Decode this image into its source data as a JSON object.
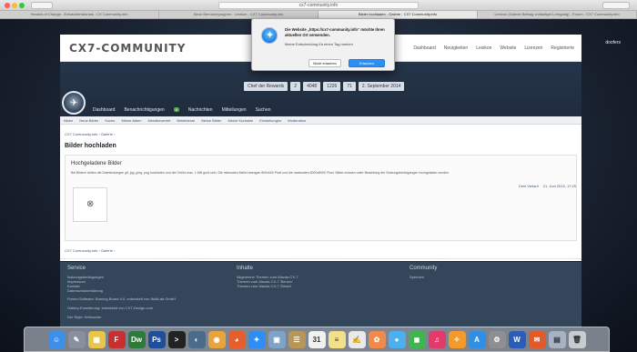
{
  "browser": {
    "url": "cx7-community.info",
    "tabs": [
      "Heralds of Change - Entwicklertutorials - CX Community.info",
      "Neue Benutzergruppen - Lexikon - CX7 Community.info",
      "Bilder hochladen - Galerie - CX7 Community.info",
      "Lexicon (Galerie Beitrag vorläufiger Lehrgang) - Forum - CX7 Community.info"
    ]
  },
  "site": {
    "logo": "CX7-COMMUNITY",
    "logo_sub": "",
    "top_nav": [
      "Dashboard",
      "Neuigkeiten",
      "Lexikon",
      "Website",
      "Lizenzen",
      "Registrierte"
    ],
    "stats": [
      "Chef der Rewards",
      "2",
      "4048",
      "1226",
      "71",
      "2. September 2014"
    ],
    "subnav": [
      "Dashboard",
      "Benachrichtigungen",
      "Nachrichten",
      "Mitteilungen",
      "Suchen"
    ],
    "subnav_badge": "9",
    "crumbs_bar": [
      "Alben",
      "Neue Bilder",
      "Suche",
      "Meine Alben",
      "Meistbewertet",
      "Beliebteste",
      "Meine Bilder",
      "Meine Kontakte",
      "Einstellungen",
      "Moderation"
    ],
    "side_tag": "doofers"
  },
  "content": {
    "crumb": "CX7 Community.info › Galerie ›",
    "page_title": "Bilder hochladen",
    "box_title": "Hochgeladene Bilder",
    "box_text": "Bei Bildern dürfen die Dateiendungen gif, jpg, jpeg, png hochladen und die Größe max. 1 MB groß sein. Die minimalen Maße betragen 800x600 Pixel und die maximalen 8000x8000 Pixel. Bilder müssen unter Beachtung der Nutzungsbedingungen hochgeladen werden.",
    "crumb2": "CX7 Community.info › Galerie ›",
    "tools": [
      "Dein Verlauf",
      "21. Juni 2015, 17:25"
    ]
  },
  "footer": {
    "col1_title": "Service",
    "col1_items": [
      "Nutzungsbedingungen",
      "Impressum",
      "Kontakt",
      "Datenschutzerklärung"
    ],
    "col2_title": "Inhalte",
    "col2_items": [
      "Allgemeine Themen zum Mazda CX-7",
      "Themen zum Mazda CX-7 'Benzin'",
      "Themen zum Mazda CX-7 'Diesel'"
    ],
    "col3_title": "Community",
    "col3_items": [
      "Spenden"
    ],
    "line1": "Forum-Software: Burning Board 4.0, entwickelt von WoltLab GmbH",
    "line2": "Gallery-Erweiterung: entwickelt von CX7-Design.com",
    "line3": "Der Style: Hörbacher"
  },
  "dialog": {
    "text": "Die Website „https://cx7-community.info“ möchte Ihren aktuellen Ort verwenden.",
    "checkbox": "Meine Entscheidung für einen Tag merken",
    "deny": "Nicht erlauben",
    "allow": "Erlauben"
  },
  "dock": {
    "icons": [
      {
        "name": "finder-icon",
        "color": "#3d8fe8",
        "glyph": "☺"
      },
      {
        "name": "launchpad-icon",
        "color": "#8a8fa0",
        "glyph": "✎"
      },
      {
        "name": "notes-icon",
        "color": "#e8c64a",
        "glyph": "▦"
      },
      {
        "name": "filezilla-icon",
        "color": "#c8302f",
        "glyph": "F"
      },
      {
        "name": "dreamweaver-icon",
        "color": "#2d7a3a",
        "glyph": "Dw"
      },
      {
        "name": "photoshop-icon",
        "color": "#1f4f9a",
        "glyph": "Ps"
      },
      {
        "name": "terminal-icon",
        "color": "#222222",
        "glyph": ">"
      },
      {
        "name": "bridge-icon",
        "color": "#4a6b8a",
        "glyph": "◐"
      },
      {
        "name": "chrome-icon",
        "color": "#e8a33a",
        "glyph": "◉"
      },
      {
        "name": "firefox-icon",
        "color": "#e85d2a",
        "glyph": "◕"
      },
      {
        "name": "safari-icon",
        "color": "#2d8ff5",
        "glyph": "✦"
      },
      {
        "name": "preview-icon",
        "color": "#7fa2c8",
        "glyph": "▣"
      },
      {
        "name": "contacts-icon",
        "color": "#b8965a",
        "glyph": "☰"
      },
      {
        "name": "calendar-icon",
        "color": "#f1f1f1",
        "glyph": "31"
      },
      {
        "name": "notes2-icon",
        "color": "#f3e08a",
        "glyph": "≡"
      },
      {
        "name": "textedit-icon",
        "color": "#e9e9e9",
        "glyph": "✍"
      },
      {
        "name": "photos-icon",
        "color": "#f08a4b",
        "glyph": "✿"
      },
      {
        "name": "messages-icon",
        "color": "#4bb0f0",
        "glyph": "●"
      },
      {
        "name": "facetime-icon",
        "color": "#3fb54d",
        "glyph": "◼"
      },
      {
        "name": "itunes-icon",
        "color": "#e23a6b",
        "glyph": "♫"
      },
      {
        "name": "ibooks-icon",
        "color": "#f39a2a",
        "glyph": "✧"
      },
      {
        "name": "appstore-icon",
        "color": "#2e8fe6",
        "glyph": "A"
      },
      {
        "name": "settings-icon",
        "color": "#8e8e93",
        "glyph": "⚙"
      },
      {
        "name": "word-icon",
        "color": "#2b5cb8",
        "glyph": "W"
      },
      {
        "name": "office-icon",
        "color": "#e05a2a",
        "glyph": "✉"
      },
      {
        "name": "downloads-icon",
        "color": "#a7b3c2",
        "glyph": "▤"
      },
      {
        "name": "trash-icon",
        "color": "#c7ccd3",
        "glyph": "🗑"
      }
    ]
  }
}
